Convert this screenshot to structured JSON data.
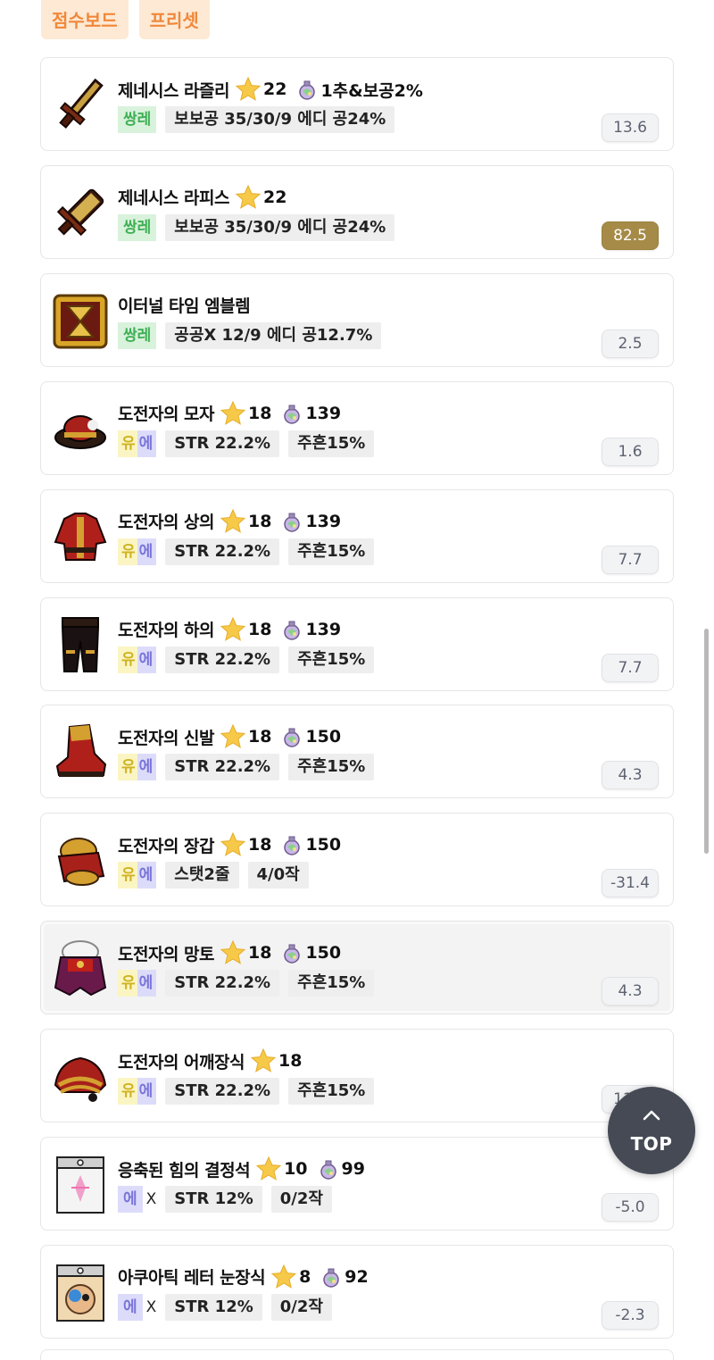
{
  "tabs": [
    "점수보드",
    "프리셋"
  ],
  "items": [
    {
      "name": "제네시스 라즐리",
      "stars": "22",
      "potential": "1추&보공2%",
      "grade": "쌍레",
      "tags": [
        "보보공 35/30/9 에디 공24%"
      ],
      "score": "13.6",
      "highlight": false,
      "gold": false,
      "icon": "genesis-lazuli-icon"
    },
    {
      "name": "제네시스 라피스",
      "stars": "22",
      "potential": null,
      "grade": "쌍레",
      "tags": [
        "보보공 35/30/9 에디 공24%"
      ],
      "score": "82.5",
      "highlight": false,
      "gold": true,
      "icon": "genesis-lapis-icon"
    },
    {
      "name": "이터널 타임 엠블렘",
      "stars": null,
      "potential": null,
      "grade": "쌍레",
      "tags": [
        "공공X 12/9 에디 공12.7%"
      ],
      "score": "2.5",
      "highlight": false,
      "gold": false,
      "icon": "eternal-time-emblem-icon"
    },
    {
      "name": "도전자의 모자",
      "stars": "18",
      "potential": "139",
      "grade": "유에",
      "tags": [
        "STR 22.2%",
        "주흔15%"
      ],
      "score": "1.6",
      "highlight": false,
      "gold": false,
      "icon": "challenger-hat-icon"
    },
    {
      "name": "도전자의 상의",
      "stars": "18",
      "potential": "139",
      "grade": "유에",
      "tags": [
        "STR 22.2%",
        "주흔15%"
      ],
      "score": "7.7",
      "highlight": false,
      "gold": false,
      "icon": "challenger-top-icon"
    },
    {
      "name": "도전자의 하의",
      "stars": "18",
      "potential": "139",
      "grade": "유에",
      "tags": [
        "STR 22.2%",
        "주흔15%"
      ],
      "score": "7.7",
      "highlight": false,
      "gold": false,
      "icon": "challenger-bottom-icon"
    },
    {
      "name": "도전자의 신발",
      "stars": "18",
      "potential": "150",
      "grade": "유에",
      "tags": [
        "STR 22.2%",
        "주흔15%"
      ],
      "score": "4.3",
      "highlight": false,
      "gold": false,
      "icon": "challenger-shoes-icon"
    },
    {
      "name": "도전자의 장갑",
      "stars": "18",
      "potential": "150",
      "grade": "유에",
      "tags": [
        "스탯2줄",
        "4/0작"
      ],
      "score": "-31.4",
      "highlight": false,
      "gold": false,
      "icon": "challenger-gloves-icon"
    },
    {
      "name": "도전자의 망토",
      "stars": "18",
      "potential": "150",
      "grade": "유에",
      "tags": [
        "STR 22.2%",
        "주흔15%"
      ],
      "score": "4.3",
      "highlight": true,
      "gold": false,
      "icon": "challenger-cape-icon"
    },
    {
      "name": "도전자의 어깨장식",
      "stars": "18",
      "potential": null,
      "grade": "유에",
      "tags": [
        "STR 22.2%",
        "주흔15%"
      ],
      "score": "11.3",
      "highlight": false,
      "gold": false,
      "icon": "challenger-shoulder-icon"
    },
    {
      "name": "응축된 힘의 결정석",
      "stars": "10",
      "potential": "99",
      "grade": "에X",
      "tags": [
        "STR 12%",
        "0/2작"
      ],
      "score": "-5.0",
      "highlight": false,
      "gold": false,
      "icon": "condensed-crystal-icon"
    },
    {
      "name": "아쿠아틱 레터 눈장식",
      "stars": "8",
      "potential": "92",
      "grade": "에X",
      "tags": [
        "STR 12%",
        "0/2작"
      ],
      "score": "-2.3",
      "highlight": false,
      "gold": false,
      "icon": "aquatic-letter-eye-icon"
    }
  ],
  "top_button": {
    "label": "TOP"
  },
  "colors": {
    "star": "#f7c948",
    "gold_score": "#a58b47",
    "tab_text": "#f0883a",
    "tab_bg": "#fde9d4"
  }
}
